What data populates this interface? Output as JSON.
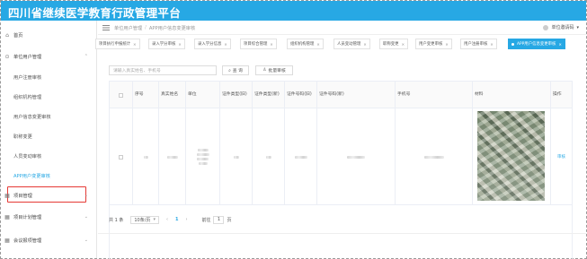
{
  "app": {
    "title": "四川省继续医学教育行政管理平台"
  },
  "header": {
    "breadcrumb": [
      "单位用户管理",
      "APP用户信息变更审核"
    ],
    "user_label": "单位邀请码"
  },
  "sidebar": {
    "home": "首页",
    "groups": [
      {
        "label": "单位用户管理",
        "expanded": true,
        "items": [
          "用户注册审核",
          "组织机构管理",
          "用户信息变更审核",
          "职称变更",
          "人员变动审核",
          "APP用户变更审核"
        ],
        "active_item": "APP用户变更审核"
      },
      {
        "label": "项目管理",
        "expanded": false
      },
      {
        "label": "项目计划管理",
        "expanded": false
      },
      {
        "label": "会议报项管理",
        "expanded": false
      }
    ]
  },
  "tabs": [
    {
      "label": "项目执行申报统计",
      "active": false
    },
    {
      "label": "录入学分审核",
      "active": false
    },
    {
      "label": "录入学分信息",
      "active": false
    },
    {
      "label": "项目综合管理",
      "active": false
    },
    {
      "label": "组织机构管理",
      "active": false
    },
    {
      "label": "人员变动管理",
      "active": false
    },
    {
      "label": "职称变更",
      "active": false
    },
    {
      "label": "用户变更审核",
      "active": false
    },
    {
      "label": "用户注册审核",
      "active": false
    },
    {
      "label": "APP用户信息变更审核",
      "active": true
    }
  ],
  "search": {
    "placeholder": "请输入真实姓名、手机号",
    "query_label": "查 询",
    "batch_label": "批量审核"
  },
  "table": {
    "columns": [
      "序号",
      "真实姓名",
      "单位",
      "证件类型(旧)",
      "证件类型(新)",
      "证件号码(旧)",
      "证件号码(新)",
      "手机号",
      "材料",
      "操作"
    ],
    "rows": [
      {
        "action": "审核"
      }
    ]
  },
  "pagination": {
    "total": "共 1 条",
    "page_size": "10条/页",
    "current_page": "1",
    "goto_prefix": "前往",
    "goto_value": "1",
    "goto_suffix": "页"
  },
  "colors": {
    "accent": "#27a8e4",
    "highlight_box": "#e53935"
  }
}
